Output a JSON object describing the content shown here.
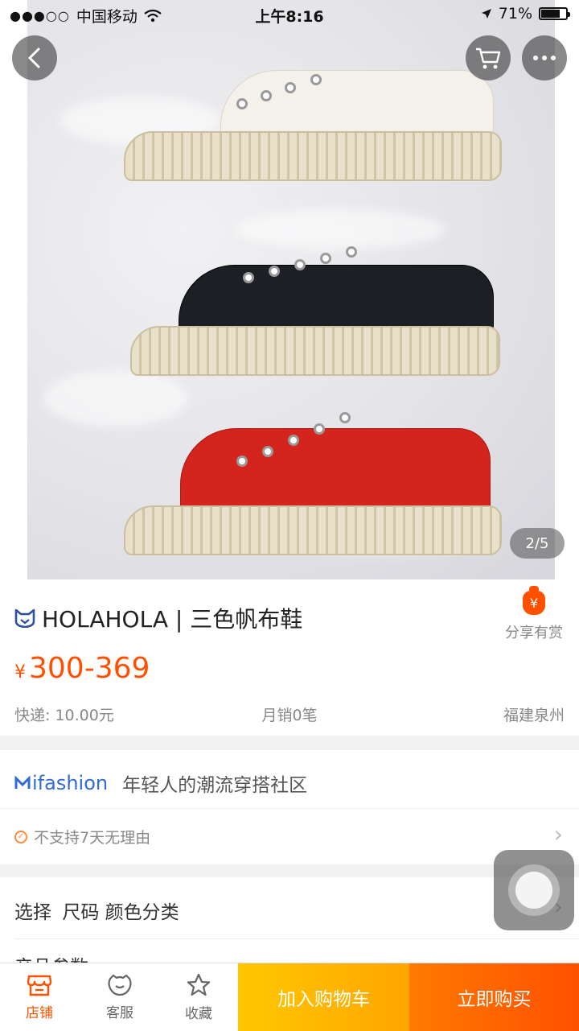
{
  "status_bar": {
    "carrier": "中国移动",
    "signal": "●●●○○",
    "time": "上午8:16",
    "battery": "71%",
    "battery_level": 0.71
  },
  "hero": {
    "counter": "2/5"
  },
  "product": {
    "brand_title": "HOLAHOLA | 三色帆布鞋",
    "price_symbol": "¥",
    "price": "300-369",
    "shipping": "快递: 10.00元",
    "monthly_sales": "月销0笔",
    "location": "福建泉州",
    "share_label": "分享有赏",
    "share_icon": "¥"
  },
  "shop": {
    "logo_text": "ifashion",
    "tagline": "年轻人的潮流穿搭社区",
    "policy": "不支持7天无理由"
  },
  "options": {
    "select_label": "选择",
    "options_text": "尺码 颜色分类",
    "params_label": "产品参数"
  },
  "bottom_bar": {
    "tabs": [
      {
        "label": "店铺",
        "icon": "store-icon"
      },
      {
        "label": "客服",
        "icon": "service-icon"
      },
      {
        "label": "收藏",
        "icon": "star-icon"
      }
    ],
    "add_to_cart": "加入购物车",
    "buy_now": "立即购买"
  },
  "colors": {
    "accent": "#ff5000",
    "cart": "#ffb000",
    "link_blue": "#2f6bd9"
  }
}
